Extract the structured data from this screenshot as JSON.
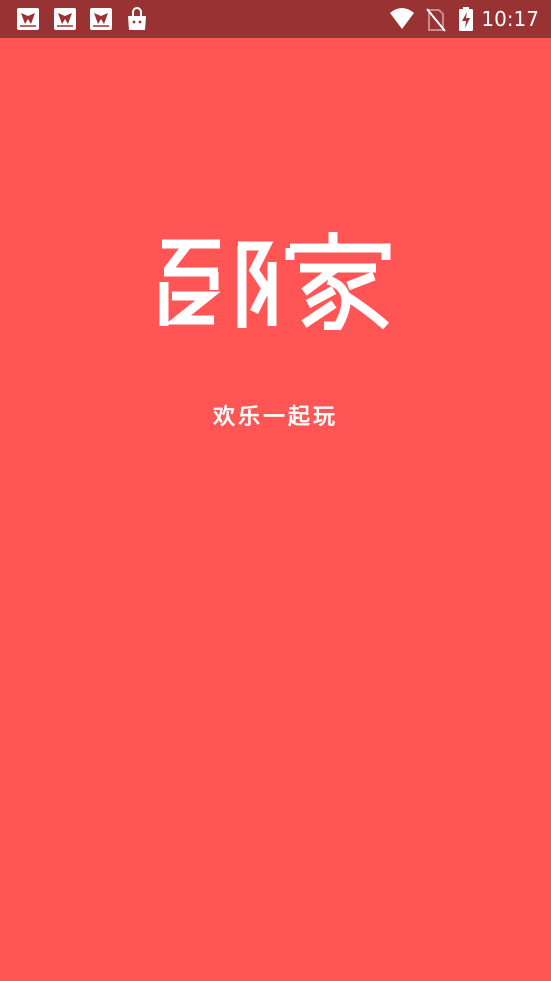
{
  "status_bar": {
    "time": "10:17",
    "notification_icons": [
      "kite-app-icon",
      "kite-app-icon",
      "kite-app-icon",
      "shopping-bag-icon"
    ],
    "system_icons": [
      "wifi-icon",
      "no-sim-icon",
      "battery-charging-icon"
    ],
    "background": "#993333"
  },
  "splash": {
    "background": "#ff5555",
    "logo_text": "邻家",
    "tagline": "欢乐一起玩"
  }
}
